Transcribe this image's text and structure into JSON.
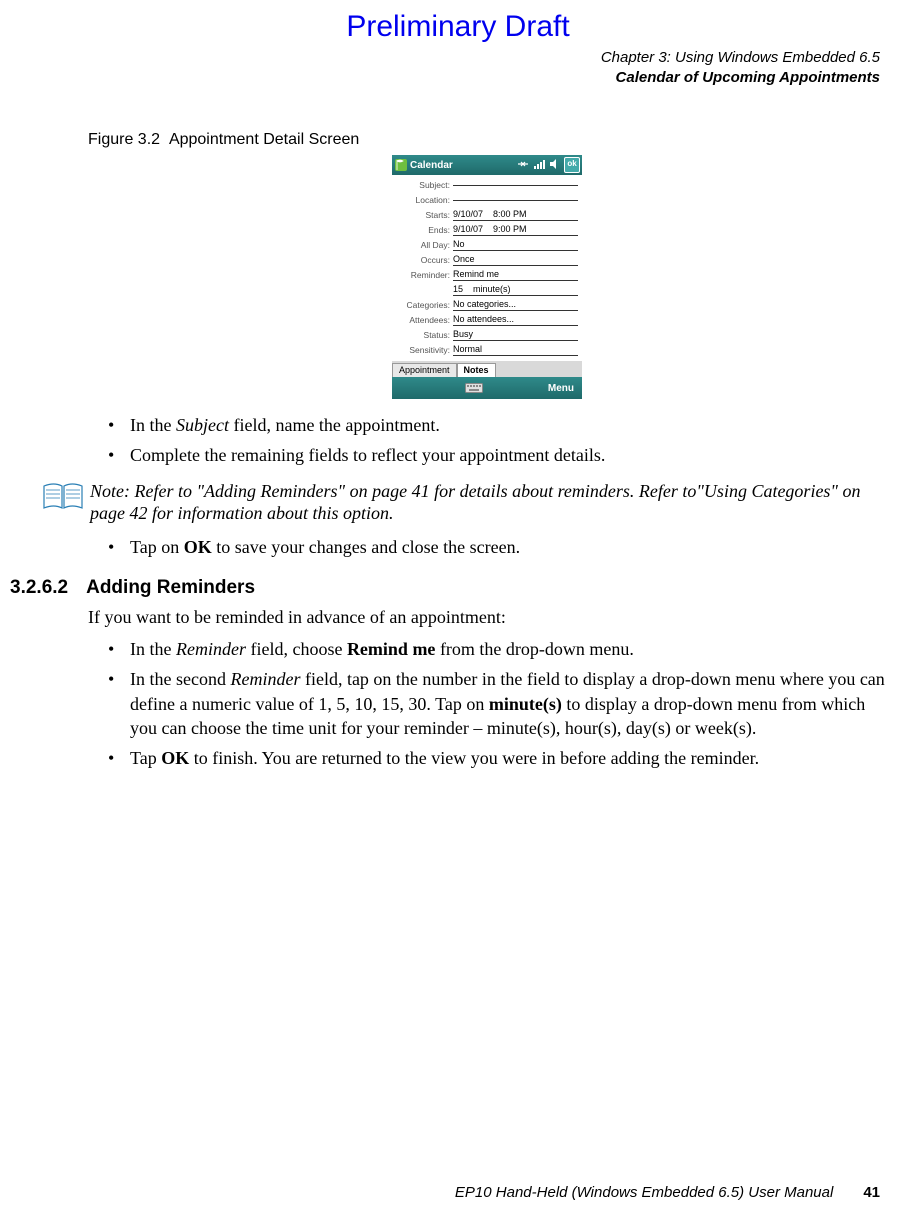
{
  "watermark": "Preliminary Draft",
  "header": {
    "chapter_line": "Chapter 3:  Using Windows Embedded 6.5",
    "section_line": "Calendar of Upcoming Appointments"
  },
  "figure": {
    "label": "Figure 3.2",
    "title": "Appointment Detail Screen"
  },
  "screenshot": {
    "title": "Calendar",
    "ok_label": "ok",
    "fields": {
      "subject_label": "Subject:",
      "subject_value": "",
      "location_label": "Location:",
      "location_value": "",
      "starts_label": "Starts:",
      "starts_date": "9/10/07",
      "starts_time": "8:00 PM",
      "ends_label": "Ends:",
      "ends_date": "9/10/07",
      "ends_time": "9:00 PM",
      "allday_label": "All Day:",
      "allday_value": "No",
      "occurs_label": "Occurs:",
      "occurs_value": "Once",
      "reminder_label": "Reminder:",
      "reminder_value": "Remind me",
      "reminder_num": "15",
      "reminder_unit": "minute(s)",
      "categories_label": "Categories:",
      "categories_value": "No categories...",
      "attendees_label": "Attendees:",
      "attendees_value": "No attendees...",
      "status_label": "Status:",
      "status_value": "Busy",
      "sensitivity_label": "Sensitivity:",
      "sensitivity_value": "Normal"
    },
    "tabs": {
      "appointment": "Appointment",
      "notes": "Notes"
    },
    "softbar": {
      "left": "",
      "right": "Menu"
    }
  },
  "bullets_a": {
    "b1_pre": "In the ",
    "b1_subject": "Subject",
    "b1_post": " field, name the appointment.",
    "b2": "Complete the remaining fields to reflect your appointment details."
  },
  "note": {
    "prefix": "Note: ",
    "text": "Refer to \"Adding Reminders\" on page 41 for details about reminders. Refer to\"Using Categories\" on page 42 for information about this option."
  },
  "bullets_b": {
    "b1_pre": "Tap on ",
    "b1_ok": "OK",
    "b1_post": " to save your changes and close the screen."
  },
  "heading": {
    "number": "3.2.6.2",
    "title": "Adding Reminders"
  },
  "para_intro": "If you want to be reminded in advance of an appointment:",
  "bullets_c": {
    "b1_pre": "In the ",
    "b1_rem": "Reminder",
    "b1_mid": " field, choose ",
    "b1_remind": "Remind me",
    "b1_post": " from the drop-down menu.",
    "b2_pre": "In the second ",
    "b2_rem": "Reminder",
    "b2_mid1": " field, tap on the number in the field to display a drop-down menu where you can define a numeric value of 1, 5, 10, 15, 30. Tap on ",
    "b2_min": "minute(s)",
    "b2_mid2": " to display a drop-down menu from which you can choose the time unit for your reminder – minute(s), hour(s), day(s) or week(s).",
    "b3_pre": "Tap ",
    "b3_ok": "OK",
    "b3_post": " to finish. You are returned to the view you were in before adding the reminder."
  },
  "footer": {
    "manual": "EP10 Hand-Held (Windows Embedded 6.5) User Manual",
    "page": "41"
  }
}
